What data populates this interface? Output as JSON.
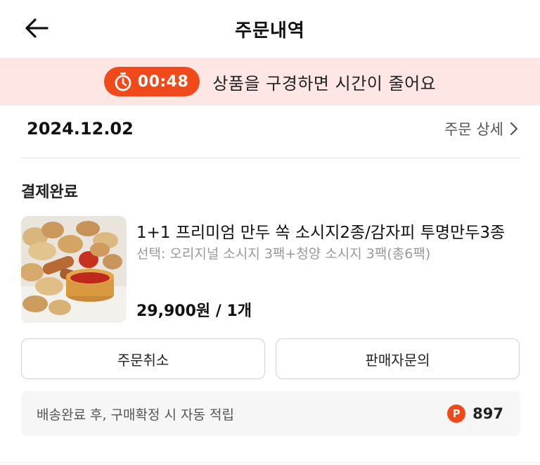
{
  "header": {
    "title": "주문내역",
    "back_icon": "arrow-left-icon"
  },
  "banner": {
    "timer": "00:48",
    "timer_icon": "stopwatch-icon",
    "message": "상품을 구경하면 시간이 줄어요",
    "accent_color": "#f04a1a",
    "background_color": "#fde6e4"
  },
  "order": {
    "date": "2024.12.02",
    "detail_label": "주문 상세",
    "status": "결제완료",
    "product": {
      "name": "1+1 프리미엄 만두 쏙 소시지2종/감자피 투명만두3종",
      "option": "선택: 오리지널 소시지 3팩+청양 소시지 3팩(총6팩)",
      "price": "29,900원 / 1개"
    },
    "buttons": {
      "cancel": "주문취소",
      "inquiry": "판매자문의"
    },
    "points": {
      "note": "배송완료 후, 구매확정 시 자동 적립",
      "badge": "P",
      "amount": "897"
    }
  }
}
